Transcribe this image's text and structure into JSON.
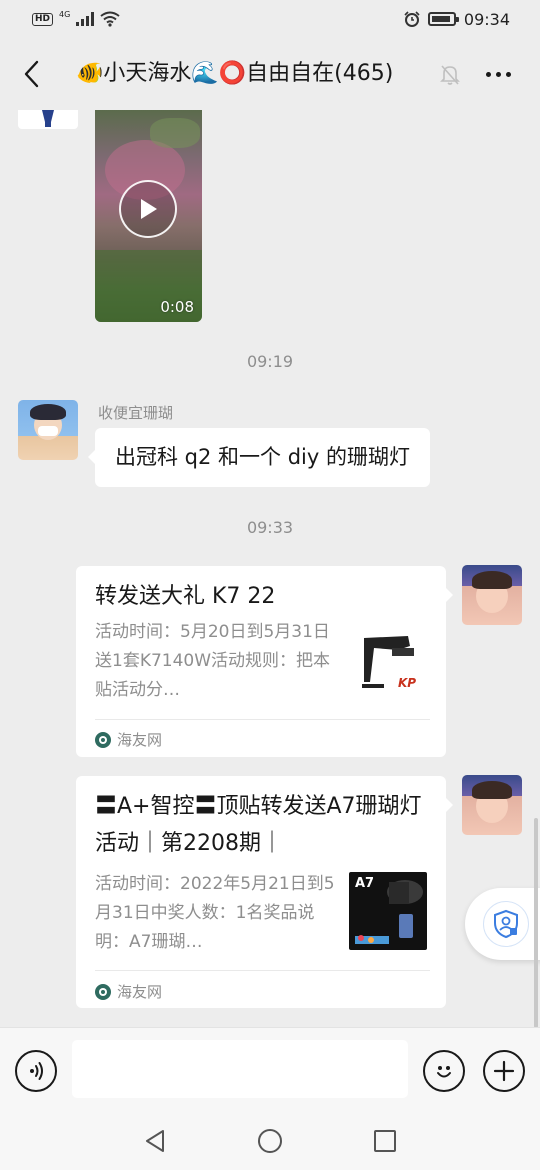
{
  "status_bar": {
    "hd": "HD",
    "network": "4G",
    "time": "09:34"
  },
  "header": {
    "title": "🐠小天海水🌊⭕自由自在(465)"
  },
  "messages": [
    {
      "kind": "video",
      "duration": "0:08"
    },
    {
      "kind": "time",
      "text": "09:19"
    },
    {
      "kind": "text",
      "sender": "收便宜珊瑚",
      "text": "出冠科 q2 和一个 diy 的珊瑚灯"
    },
    {
      "kind": "time",
      "text": "09:33"
    },
    {
      "kind": "link_card",
      "title": "转发送大礼 K7 22",
      "description": "活动时间：5月20日到5月31日送1套K7140W活动规则：把本贴活动分…",
      "thumb_text": "KP",
      "source": "海友网"
    },
    {
      "kind": "link_card",
      "title": "〓A+智控〓顶贴转发送A7珊瑚灯活动｜第2208期｜",
      "description": "活动时间：2022年5月21日到5月31日中奖人数：1名奖品说明：A7珊瑚…",
      "thumb_text": "A7",
      "source": "海友网"
    }
  ],
  "input": {
    "placeholder": ""
  },
  "icons": {
    "back": "chevron-left-icon",
    "mute": "bell-off-icon",
    "more": "more-dots-icon",
    "voice": "voice-icon",
    "emoji": "emoji-icon",
    "plus": "plus-icon",
    "shield": "shield-user-icon"
  },
  "colors": {
    "background": "#ededed",
    "bubble": "#ffffff",
    "muted_text": "#8e8e8e",
    "source_logo": "#2f6b60"
  }
}
